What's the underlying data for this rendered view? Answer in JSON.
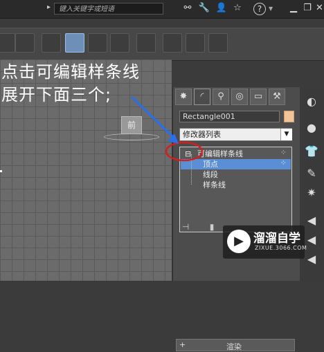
{
  "titlebar": {
    "search_placeholder": "键入关键字或短语",
    "icons": [
      "binoculars-icon",
      "wrench-icon",
      "user-icon",
      "star-icon",
      "help-icon",
      "minimize-icon",
      "restore-icon",
      "close-icon"
    ],
    "help_label": "?"
  },
  "toolbar": {
    "buttons": [
      "align-left-icon",
      "align-icon",
      "layers-icon",
      "layer-manager-icon",
      "curve-editor-icon",
      "schematic-icon",
      "material-editor-icon",
      "render-setup-icon",
      "render-frame-icon",
      "render-icon"
    ]
  },
  "annotation": {
    "line1": "点击可编辑样条线",
    "line2": "展开下面三个;"
  },
  "viewport": {
    "viewcube_label": "前"
  },
  "panel": {
    "object_name": "Rectangle001",
    "object_color": "#f2c49a",
    "modifier_list": "修改器列表",
    "stack": [
      {
        "label": "可编辑样条线",
        "prefix": "⊟",
        "selected": false
      },
      {
        "label": "顶点",
        "prefix": "",
        "selected": true
      },
      {
        "label": "线段",
        "prefix": "",
        "selected": false
      },
      {
        "label": "样条线",
        "prefix": "",
        "selected": false
      }
    ],
    "rollout_label": "渲染",
    "rollout_prefix": "+"
  },
  "watermark": {
    "title": "溜溜自学",
    "url": "ZIXUE.3066.COM"
  },
  "colors": {
    "selection": "#5a8fd6",
    "arrow": "#2a6ee8",
    "circle": "#d22020"
  }
}
